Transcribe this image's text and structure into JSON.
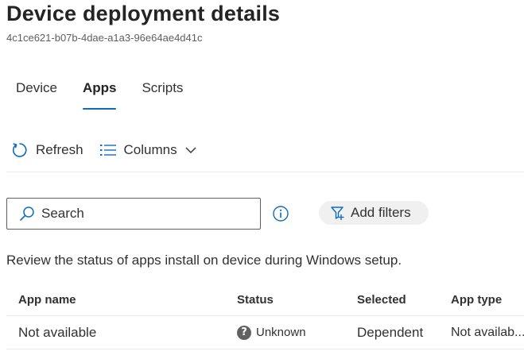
{
  "page": {
    "title": "Device deployment details",
    "subtitle": "4c1ce621-b07b-4dae-a1a3-96e64ae4d41c"
  },
  "tabs": [
    {
      "label": "Device",
      "active": false
    },
    {
      "label": "Apps",
      "active": true
    },
    {
      "label": "Scripts",
      "active": false
    }
  ],
  "toolbar": {
    "refresh_label": "Refresh",
    "columns_label": "Columns",
    "refresh_icon": "refresh-icon",
    "columns_icon": "columns-list-icon"
  },
  "filter_bar": {
    "search_placeholder": "Search",
    "add_filters_label": "Add filters"
  },
  "description": "Review the status of apps install on device during Windows setup.",
  "table": {
    "columns": [
      "App name",
      "Status",
      "Selected",
      "App type"
    ],
    "rows": [
      {
        "app_name": "Not available",
        "status": "Unknown",
        "status_icon": "question-circle-icon",
        "selected": "Dependent",
        "app_type": "Not availab..."
      }
    ]
  },
  "colors": {
    "accent": "#0f6cbd",
    "pill_bg": "#f0f0f0",
    "status_unknown": "#616161"
  }
}
